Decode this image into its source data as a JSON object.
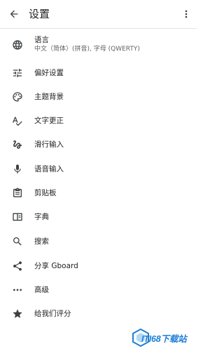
{
  "appbar": {
    "title": "设置",
    "back_icon": "arrow-back-icon",
    "more_icon": "more-vert-icon"
  },
  "items": [
    {
      "icon": "globe-icon",
      "label": "语言",
      "sub": "中文（简体）(拼音), 字母 (QWERTY)"
    },
    {
      "icon": "tune-icon",
      "label": "偏好设置"
    },
    {
      "icon": "palette-icon",
      "label": "主题背景"
    },
    {
      "icon": "spellcheck-icon",
      "label": "文字更正"
    },
    {
      "icon": "gesture-icon",
      "label": "滑行输入"
    },
    {
      "icon": "mic-icon",
      "label": "语音输入"
    },
    {
      "icon": "clipboard-icon",
      "label": "剪贴板"
    },
    {
      "icon": "book-icon",
      "label": "字典"
    },
    {
      "icon": "search-icon",
      "label": "搜索"
    },
    {
      "icon": "share-icon",
      "label": "分享 Gboard"
    },
    {
      "icon": "more-horiz-icon",
      "label": "高级"
    },
    {
      "icon": "star-icon",
      "label": "给我们评分"
    }
  ],
  "watermark": {
    "text": "ITI68下载站"
  },
  "colors": {
    "icon": "#3c4043",
    "text": "#202124",
    "subtext": "#5f6368",
    "divider": "#e3e3e3",
    "watermark": "#1f7fd6"
  }
}
